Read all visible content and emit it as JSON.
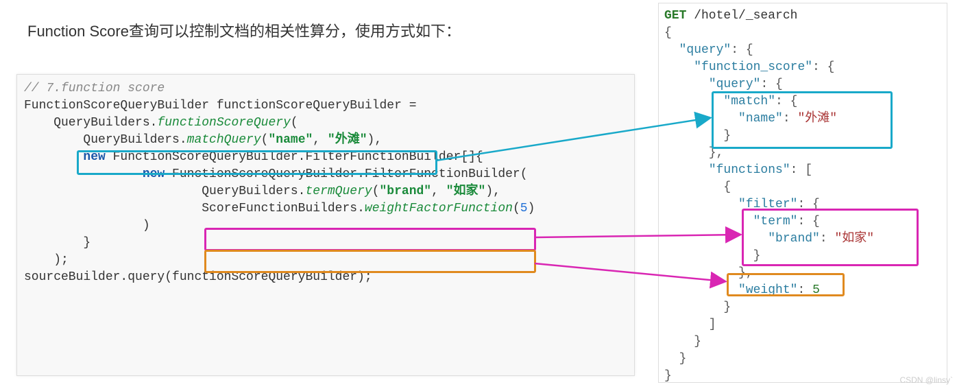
{
  "title": "Function Score查询可以控制文档的相关性算分，使用方式如下：",
  "java": {
    "comment": "// 7.function score",
    "line1": "FunctionScoreQueryBuilder functionScoreQueryBuilder =",
    "line2_pre": "    QueryBuilders.",
    "line2_method": "functionScoreQuery",
    "line2_post": "(",
    "line3_pre": "        QueryBuilders.",
    "line3_method": "matchQuery",
    "line3_paren_open": "(",
    "line3_arg1": "\"name\"",
    "line3_comma": ", ",
    "line3_arg2": "\"外滩\"",
    "line3_close": "),",
    "line4_pre": "        ",
    "line4_new": "new",
    "line4_post": " FunctionScoreQueryBuilder.FilterFunctionBuilder[]{",
    "line5_pre": "                ",
    "line5_new": "new",
    "line5_post": " FunctionScoreQueryBuilder.FilterFunctionBuilder(",
    "line6_pre": "                        QueryBuilders.",
    "line6_method": "termQuery",
    "line6_paren_open": "(",
    "line6_arg1": "\"brand\"",
    "line6_comma": ", ",
    "line6_arg2": "\"如家\"",
    "line6_close": "),",
    "line7_pre": "                        ScoreFunctionBuilders.",
    "line7_method": "weightFactorFunction",
    "line7_paren_open": "(",
    "line7_arg": "5",
    "line7_close": ")",
    "line8": "                )",
    "line9": "        }",
    "line10": "    );",
    "line11": "sourceBuilder.query(functionScoreQueryBuilder);"
  },
  "json": {
    "l1a": "GET",
    "l1b": " /hotel/_search",
    "l2": "{",
    "l3a": "  ",
    "l3k": "\"query\"",
    "l3b": ": {",
    "l4a": "    ",
    "l4k": "\"function_score\"",
    "l4b": ": {",
    "l5a": "      ",
    "l5k": "\"query\"",
    "l5b": ": {",
    "l6a": "        ",
    "l6k": "\"match\"",
    "l6b": ": {",
    "l7a": "          ",
    "l7k": "\"name\"",
    "l7b": ": ",
    "l7v": "\"外滩\"",
    "l8": "        }",
    "l9": "      },",
    "l10a": "      ",
    "l10k": "\"functions\"",
    "l10b": ": [",
    "l11": "        {",
    "l12a": "          ",
    "l12k": "\"filter\"",
    "l12b": ": {",
    "l13a": "            ",
    "l13k": "\"term\"",
    "l13b": ": {",
    "l14a": "              ",
    "l14k": "\"brand\"",
    "l14b": ": ",
    "l14v": "\"如家\"",
    "l15": "            }",
    "l16": "          },",
    "l17a": "          ",
    "l17k": "\"weight\"",
    "l17b": ": ",
    "l17v": "5",
    "l18": "        }",
    "l19": "      ]",
    "l20": "    }",
    "l21": "  }",
    "l22": "}"
  },
  "watermark": "CSDN @linsy`"
}
